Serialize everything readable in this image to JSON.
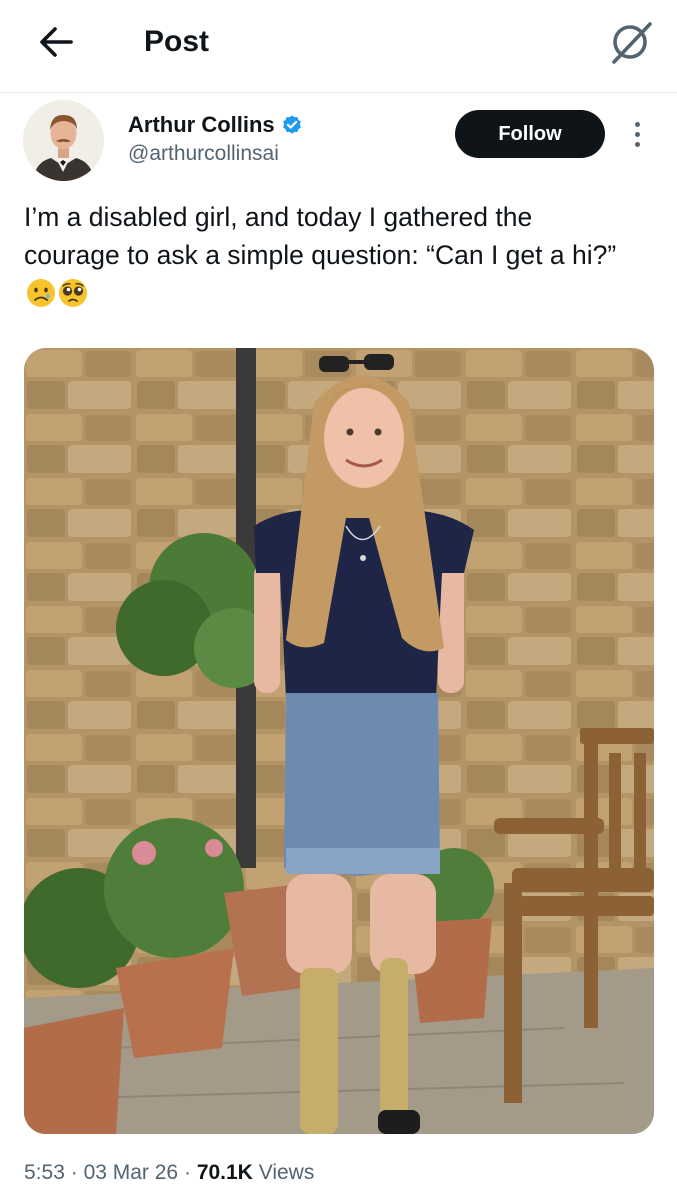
{
  "header": {
    "title": "Post",
    "back_icon": "arrow-left-icon",
    "grok_icon": "grok-icon"
  },
  "author": {
    "name": "Arthur Collins",
    "handle": "@arthurcollinsai",
    "verified_icon": "verified-badge-icon",
    "verified_color": "#1d9bf0"
  },
  "actions": {
    "follow_label": "Follow",
    "more_icon": "more-vertical-icon"
  },
  "post": {
    "text": "I’m a disabled girl, and today I gathered the courage to ask a simple question: “Can I get a hi?”",
    "emojis": [
      "crying-face-emoji",
      "pleading-face-emoji"
    ]
  },
  "meta": {
    "time": "5:53",
    "date": "03 Mar 26",
    "views_count": "70.1K",
    "views_label": "Views",
    "separator": "·"
  },
  "colors": {
    "text_primary": "#0f1419",
    "text_secondary": "#536471",
    "follow_bg": "#0f1419",
    "verified": "#1d9bf0"
  }
}
